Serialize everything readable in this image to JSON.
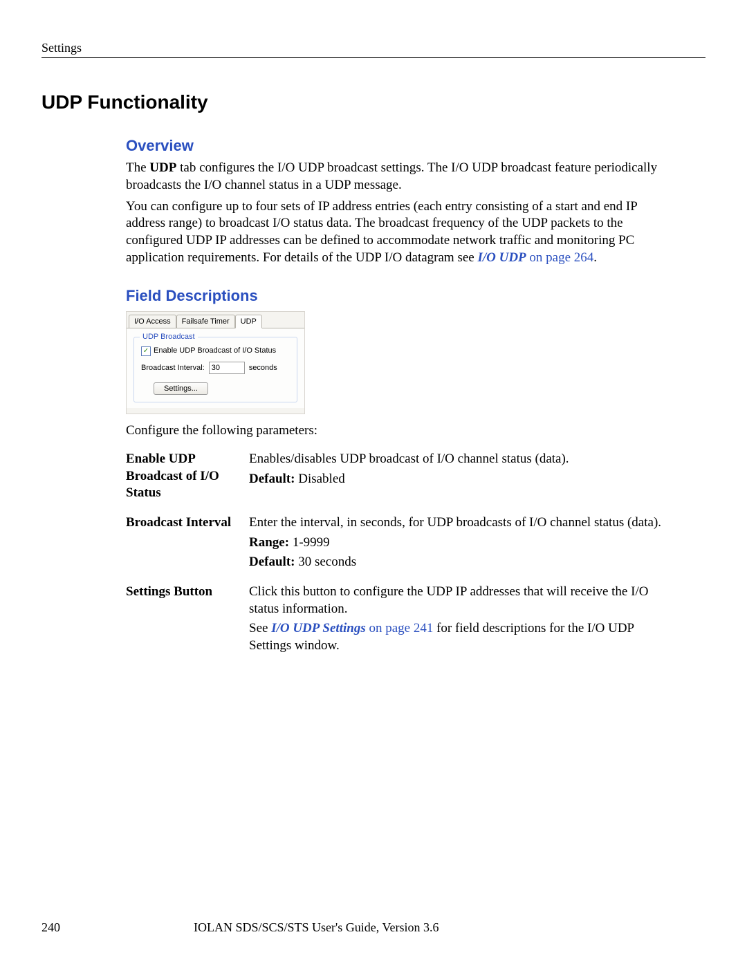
{
  "header": {
    "running": "Settings"
  },
  "title": "UDP Functionality",
  "overview": {
    "heading": "Overview",
    "p1_pre": "The ",
    "p1_bold": "UDP",
    "p1_post": " tab configures the I/O UDP broadcast settings. The I/O UDP broadcast feature periodically broadcasts the I/O channel status in a UDP message.",
    "p2_pre": "You can configure up to four sets of IP address entries (each entry consisting of a start and end IP address range) to broadcast I/O status data. The broadcast frequency of the UDP packets to the configured UDP IP addresses can be defined to accommodate network traffic and monitoring PC application requirements. For details of the UDP I/O datagram see ",
    "p2_link_ital": "I/O UDP",
    "p2_link_rest": " on page 264",
    "p2_post": "."
  },
  "fielddesc": {
    "heading": "Field Descriptions",
    "ui": {
      "tabs": {
        "t1": "I/O Access",
        "t2": "Failsafe Timer",
        "t3": "UDP"
      },
      "group_legend": "UDP Broadcast",
      "checkbox_label": "Enable UDP Broadcast of I/O Status",
      "interval_label": "Broadcast Interval:",
      "interval_value": "30",
      "interval_unit": "seconds",
      "settings_button": "Settings..."
    },
    "intro": "Configure the following parameters:",
    "rows": {
      "r1": {
        "label": "Enable UDP Broadcast of I/O Status",
        "desc": "Enables/disables UDP broadcast of I/O channel status (data).",
        "def_label": "Default:",
        "def_val": " Disabled"
      },
      "r2": {
        "label": "Broadcast Interval",
        "desc": "Enter the interval, in seconds, for UDP broadcasts of I/O channel status (data).",
        "range_label": "Range:",
        "range_val": " 1-9999",
        "def_label": "Default:",
        "def_val": " 30 seconds"
      },
      "r3": {
        "label": "Settings Button",
        "desc": "Click this button to configure the UDP IP addresses that will receive the I/O status information.",
        "see_pre": "See ",
        "see_link_ital": "I/O UDP Settings",
        "see_link_rest": " on page 241",
        "see_post": " for field descriptions for the I/O UDP Settings window."
      }
    }
  },
  "footer": {
    "page": "240",
    "text": "IOLAN SDS/SCS/STS User's Guide, Version 3.6"
  }
}
